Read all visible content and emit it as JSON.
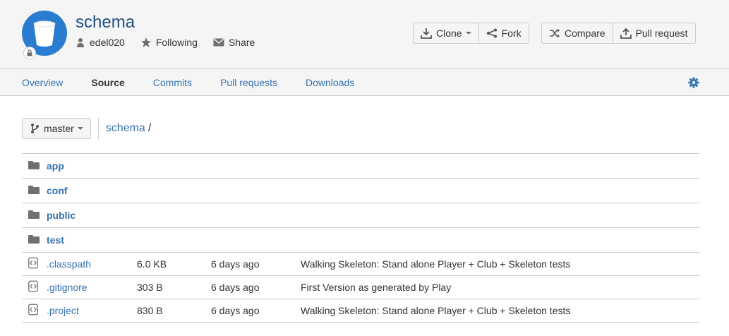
{
  "repo": {
    "title": "schema",
    "owner": "edel020",
    "following_label": "Following",
    "share_label": "Share"
  },
  "actions": {
    "clone": "Clone",
    "fork": "Fork",
    "compare": "Compare",
    "pull_request": "Pull request"
  },
  "tabs": [
    {
      "label": "Overview"
    },
    {
      "label": "Source"
    },
    {
      "label": "Commits"
    },
    {
      "label": "Pull requests"
    },
    {
      "label": "Downloads"
    }
  ],
  "branch": {
    "name": "master"
  },
  "breadcrumb": {
    "repo": "schema",
    "separator": "/"
  },
  "directories": [
    {
      "name": "app"
    },
    {
      "name": "conf"
    },
    {
      "name": "public"
    },
    {
      "name": "test"
    }
  ],
  "files": [
    {
      "name": ".classpath",
      "size": "6.0 KB",
      "date": "6 days ago",
      "message": "Walking Skeleton: Stand alone Player + Club + Skeleton tests"
    },
    {
      "name": ".gitignore",
      "size": "303 B",
      "date": "6 days ago",
      "message": "First Version as generated by Play"
    },
    {
      "name": ".project",
      "size": "830 B",
      "date": "6 days ago",
      "message": "Walking Skeleton: Stand alone Player + Club + Skeleton tests"
    }
  ],
  "colors": {
    "link": "#3572b0",
    "brand": "#205081",
    "avatar": "#2a7cd0"
  }
}
